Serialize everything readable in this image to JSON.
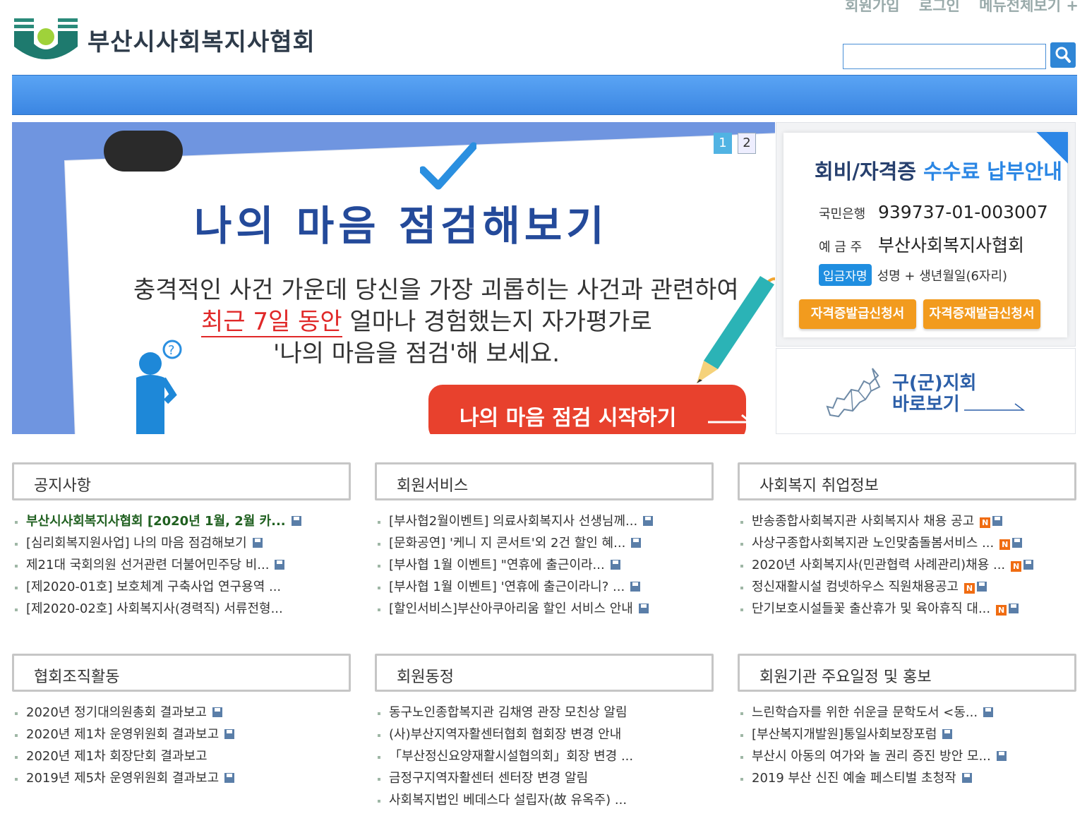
{
  "header": {
    "logo_text": "부산시사회복지사협회",
    "top_links": [
      "회원가입",
      "로그인",
      "메뉴전체보기 +"
    ],
    "search": {
      "placeholder": "",
      "button": "search"
    }
  },
  "banner": {
    "pager": [
      "1",
      "2"
    ],
    "active_page": "1",
    "title": "나의 마음 점검해보기",
    "line1": "충격적인 사건 가운데 당신을 가장 괴롭히는 사건과 관련하여",
    "line2_highlight": "최근 7일 동안",
    "line2_rest": " 얼마나 경험했는지 자가평가로",
    "line3": "'나의 마음을 점검'해 보세요.",
    "cta": "나의 마음 점검 시작하기"
  },
  "fee": {
    "title_a": "회비/자격증 ",
    "title_b": "수수료 납부안내",
    "bank_label": "국민은행",
    "account": "939737-01-003007",
    "holder_label": "예 금 주",
    "holder": "부산사회복지사협회",
    "depositor_badge": "입금자명",
    "depositor": "성명 + 생년월일(6자리)",
    "btn1": "자격증발급신청서",
    "btn2": "자격증재발급신청서"
  },
  "branch": {
    "line1": "구(군)지회",
    "line2": "바로보기"
  },
  "colors": {
    "nav": "#3b86e2",
    "accent": "#2a86e4",
    "cta": "#e8412d",
    "button": "#f29b1e",
    "new_badge": "#f06c12"
  },
  "boxes": {
    "notice": {
      "title": "공지사항",
      "items": [
        {
          "text": "부산시사회복지사협회 [2020년 1월, 2월 카...",
          "file": true,
          "new": false
        },
        {
          "text": "[심리회복지원사업] 나의 마음 점검해보기",
          "file": true,
          "new": false
        },
        {
          "text": "제21대 국회의원 선거관련 더불어민주당 비...",
          "file": true,
          "new": false
        },
        {
          "text": "[제2020-01호] 보호체계 구축사업 연구용역 ...",
          "file": false,
          "new": false
        },
        {
          "text": "[제2020-02호] 사회복지사(경력직) 서류전형...",
          "file": false,
          "new": false
        }
      ]
    },
    "member": {
      "title": "회원서비스",
      "items": [
        {
          "text": "[부사협2월이벤트] 의료사회복지사 선생님께...",
          "file": true,
          "new": false
        },
        {
          "text": "[문화공연] '케니 지 콘서트'외 2건 할인 혜...",
          "file": true,
          "new": false
        },
        {
          "text": "[부사협 1월 이벤트] \"연휴에 출근이라...",
          "file": true,
          "new": false
        },
        {
          "text": "[부사협 1월 이벤트] '연휴에 출근이라니? ...",
          "file": true,
          "new": false
        },
        {
          "text": "[할인서비스]부산아쿠아리움 할인 서비스 안내",
          "file": true,
          "new": false
        }
      ]
    },
    "jobs": {
      "title": "사회복지 취업정보",
      "items": [
        {
          "text": "반송종합사회복지관 사회복지사 채용 공고",
          "file": true,
          "new": true
        },
        {
          "text": "사상구종합사회복지관 노인맞춤돌봄서비스 ...",
          "file": true,
          "new": true
        },
        {
          "text": "2020년 사회복지사(민관협력 사례관리)채용 ...",
          "file": true,
          "new": true
        },
        {
          "text": "정신재활시설 컴넷하우스 직원채용공고",
          "file": true,
          "new": true
        },
        {
          "text": "단기보호시설들꽃 출산휴가 및 육아휴직 대...",
          "file": true,
          "new": true
        }
      ]
    },
    "org": {
      "title": "협회조직활동",
      "items": [
        {
          "text": "2020년 정기대의원총회 결과보고",
          "file": true,
          "new": false
        },
        {
          "text": "2020년 제1차 운영위원회 결과보고",
          "file": true,
          "new": false
        },
        {
          "text": "2020년 제1차 회장단회 결과보고",
          "file": false,
          "new": false
        },
        {
          "text": "2019년 제5차 운영위원회 결과보고",
          "file": true,
          "new": false
        }
      ]
    },
    "news": {
      "title": "회원동정",
      "items": [
        {
          "text": "동구노인종합복지관 김채영 관장 모친상 알림",
          "file": false,
          "new": false
        },
        {
          "text": "(사)부산지역자활센터협회 협회장 변경 안내",
          "file": false,
          "new": false
        },
        {
          "text": "「부산정신요양재활시설협의회」회장 변경 ...",
          "file": false,
          "new": false
        },
        {
          "text": "금정구지역자활센터 센터장 변경 알림",
          "file": false,
          "new": false
        },
        {
          "text": "사회복지법인 베데스다 설립자(故 유옥주) ...",
          "file": false,
          "new": false
        }
      ]
    },
    "events": {
      "title": "회원기관 주요일정 및 홍보",
      "items": [
        {
          "text": "느린학습자를 위한 쉬운글 문학도서 <동...",
          "file": true,
          "new": false
        },
        {
          "text": "[부산복지개발원]통일사회보장포럼",
          "file": true,
          "new": false
        },
        {
          "text": "부산시 아동의 여가와 놀 권리 증진 방안 모...",
          "file": true,
          "new": false
        },
        {
          "text": "2019 부산 신진 예술 페스티벌 초청작",
          "file": true,
          "new": false
        },
        {
          "text": "2019 부산 신진 예술 페스티벌 초청작",
          "file": true,
          "new": false
        }
      ]
    }
  }
}
